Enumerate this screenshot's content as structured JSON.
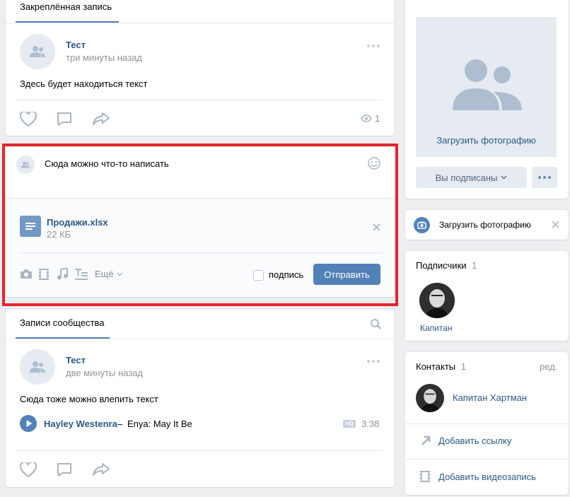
{
  "pinned": {
    "tab": "Закреплённая запись",
    "author": "Тест",
    "time": "три минуты назад",
    "text": "Здесь будет находиться текст",
    "views": "1"
  },
  "composer": {
    "placeholder": "Сюда можно что-то написать",
    "attachment_name": "Продажи.xlsx",
    "attachment_size": "22 КБ",
    "more_label": "Ещё",
    "signature_label": "подпись",
    "send_label": "Отправить"
  },
  "community": {
    "tab": "Записи сообщества",
    "author": "Тест",
    "time": "две минуты назад",
    "text": "Сюда тоже можно влепить текст",
    "track_artist": "Hayley Westenra",
    "track_dash": "–",
    "track_title": "Enya: May It Be",
    "track_quality": "HQ",
    "track_duration": "3:38"
  },
  "profile": {
    "upload_photo": "Загрузить фотографию",
    "subscribed": "Вы подписаны"
  },
  "upload_bar": {
    "label": "Загрузить фотографию"
  },
  "subscribers": {
    "title": "Подписчики",
    "count": "1",
    "name": "Капитан"
  },
  "contacts": {
    "title": "Контакты",
    "count": "1",
    "edit": "ред.",
    "name": "Капитан Хартман",
    "add_link": "Добавить ссылку",
    "add_video": "Добавить видеозапись"
  },
  "colors": {
    "accent": "#5181b8",
    "link": "#2a5885",
    "highlight": "#e4252d"
  }
}
